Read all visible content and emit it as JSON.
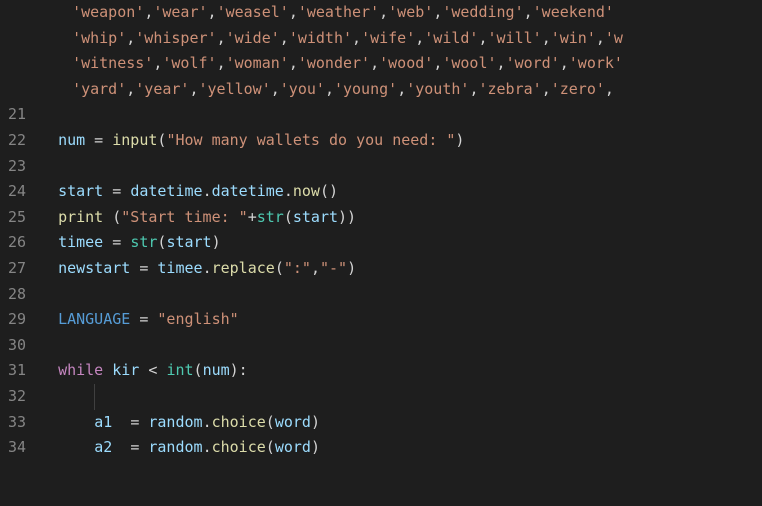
{
  "gutter": {
    "blank_top_count": 4,
    "start": 21,
    "end": 34
  },
  "code": {
    "wrapped_words": [
      [
        "weapon",
        "wear",
        "weasel",
        "weather",
        "web",
        "wedding",
        "weekend"
      ],
      [
        "whip",
        "whisper",
        "wide",
        "width",
        "wife",
        "wild",
        "will",
        "win",
        "w"
      ],
      [
        "witness",
        "wolf",
        "woman",
        "wonder",
        "wood",
        "wool",
        "word",
        "work"
      ],
      [
        "yard",
        "year",
        "yellow",
        "you",
        "young",
        "youth",
        "zebra",
        "zero"
      ]
    ],
    "l22": {
      "var": "num",
      "fn": "input",
      "str": "\"How many wallets do you need: \""
    },
    "l24": {
      "var": "start",
      "mod1": "datetime",
      "mod2": "datetime",
      "fn": "now"
    },
    "l25": {
      "fn1": "print",
      "str": "\"Start time: \"",
      "fn2": "str",
      "arg": "start"
    },
    "l26": {
      "var": "timee",
      "fn": "str",
      "arg": "start"
    },
    "l27": {
      "var": "newstart",
      "obj": "timee",
      "fn": "replace",
      "s1": "\":\"",
      "s2": "\"-\""
    },
    "l29": {
      "var": "LANGUAGE",
      "str": "\"english\""
    },
    "l31": {
      "kw": "while",
      "v1": "kir",
      "op": "<",
      "fn": "int",
      "arg": "num"
    },
    "l33": {
      "var": "a1",
      "mod": "random",
      "fn": "choice",
      "arg": "word"
    },
    "l34": {
      "var": "a2",
      "mod": "random",
      "fn": "choice",
      "arg": "word"
    }
  }
}
